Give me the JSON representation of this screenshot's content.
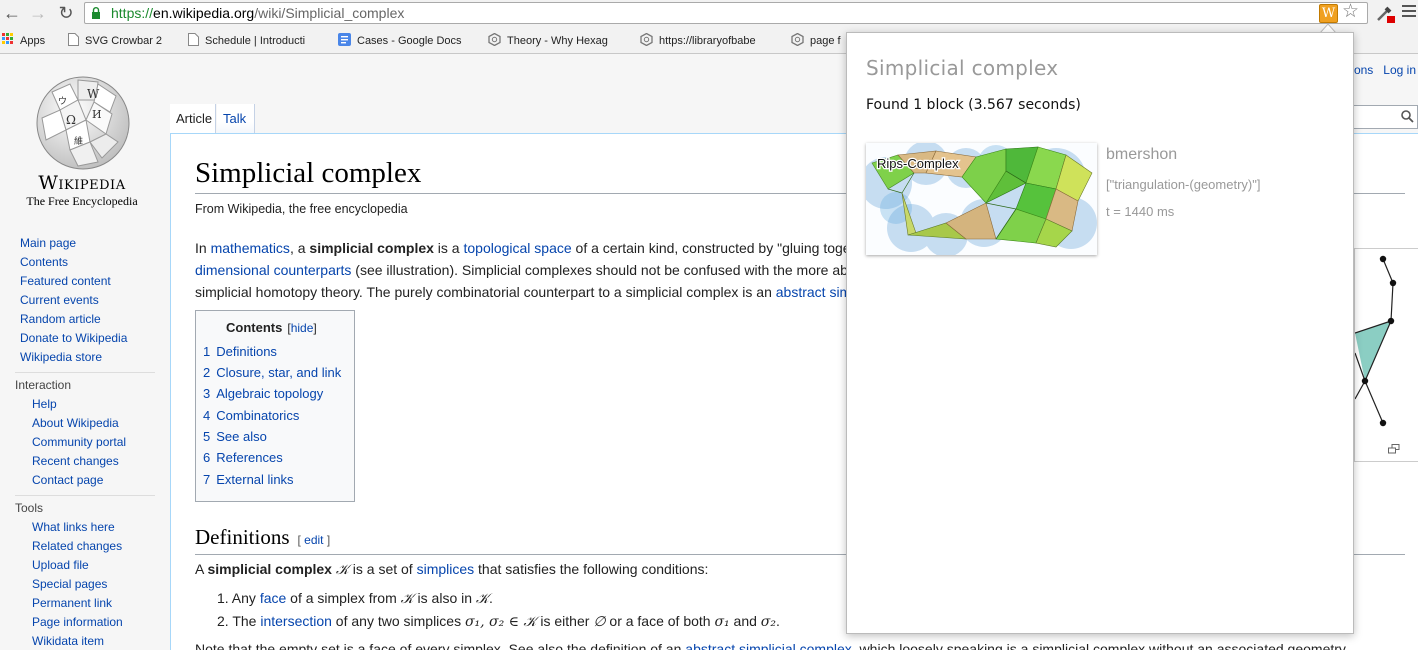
{
  "browser": {
    "url_scheme": "https://",
    "url_host": "en.wikipedia.org",
    "url_path": "/wiki/Simplicial_complex",
    "extension_letter": "W",
    "bookmarks": [
      {
        "label": "Apps",
        "icon": "apps-grid-icon"
      },
      {
        "label": "SVG Crowbar 2",
        "icon": "page-icon"
      },
      {
        "label": "Schedule | Introducti",
        "icon": "page-icon"
      },
      {
        "label": "Cases - Google Docs",
        "icon": "google-docs-icon"
      },
      {
        "label": "Theory - Why Hexag",
        "icon": "site-icon"
      },
      {
        "label": "https://libraryofbabe",
        "icon": "site-icon"
      },
      {
        "label": "page f",
        "icon": "site-icon"
      }
    ]
  },
  "wiki": {
    "wordmark": "Wikipedia",
    "tagline": "The Free Encyclopedia",
    "user_links": "ions   Log in",
    "nav": [
      "Main page",
      "Contents",
      "Featured content",
      "Current events",
      "Random article",
      "Donate to Wikipedia",
      "Wikipedia store"
    ],
    "interaction_heading": "Interaction",
    "interaction": [
      "Help",
      "About Wikipedia",
      "Community portal",
      "Recent changes",
      "Contact page"
    ],
    "tools_heading": "Tools",
    "tools": [
      "What links here",
      "Related changes",
      "Upload file",
      "Special pages",
      "Permanent link",
      "Page information",
      "Wikidata item"
    ],
    "tabs": [
      "Article",
      "Talk"
    ],
    "title": "Simplicial complex",
    "site_sub": "From Wikipedia, the free encyclopedia",
    "intro": {
      "l1_a": "In ",
      "l1_link1": "mathematics",
      "l1_b": ", a ",
      "l1_bold": "simplicial complex",
      "l1_c": " is a ",
      "l1_link2": "topological space",
      "l1_d": " of a certain kind, constructed by \"gluing toge",
      "l2_link": "dimensional counterparts",
      "l2_rest": " (see illustration). Simplicial complexes should not be confused with the more ab",
      "l3_a": "simplicial homotopy theory. The purely combinatorial counterpart to a simplicial complex is an ",
      "l3_link": "abstract sim"
    },
    "toc": {
      "title": "Contents",
      "hide": "hide",
      "items": [
        {
          "num": "1",
          "label": "Definitions"
        },
        {
          "num": "2",
          "label": "Closure, star, and link"
        },
        {
          "num": "3",
          "label": "Algebraic topology"
        },
        {
          "num": "4",
          "label": "Combinatorics"
        },
        {
          "num": "5",
          "label": "See also"
        },
        {
          "num": "6",
          "label": "References"
        },
        {
          "num": "7",
          "label": "External links"
        }
      ]
    },
    "definitions": {
      "heading": "Definitions",
      "edit": "edit",
      "p_a": "A ",
      "p_bold": "simplicial complex",
      "p_sym": "𝒦",
      "p_b": " is a set of ",
      "p_link": "simplices",
      "p_c": " that satisfies the following conditions:",
      "li1_a": "1. Any ",
      "li1_link": "face",
      "li1_b": " of a simplex from ",
      "li1_sym": "𝒦",
      "li1_c": " is also in ",
      "li1_sym2": "𝒦",
      "li1_d": ".",
      "li2_a": "2. The ",
      "li2_link": "intersection",
      "li2_b": " of any two simplices ",
      "li2_math": "σ₁, σ₂ ∈ 𝒦",
      "li2_c": " is either ",
      "li2_empty": "∅",
      "li2_d": " or a face of both ",
      "li2_s1": "σ₁",
      "li2_e": " and ",
      "li2_s2": "σ₂",
      "li2_f": ".",
      "note_a": "Note that the empty set is a face of every simplex. See also the definition of an ",
      "note_link": "abstract simplicial complex",
      "note_b": ", which loosely speaking is a simplicial complex without an associated geometry."
    }
  },
  "popup": {
    "title": "Simplicial complex",
    "status": "Found 1 block (3.567 seconds)",
    "block": {
      "thumb_label": "Rips-Complex",
      "user": "bmershon",
      "tags": "[\"triangulation-(geometry)\"]",
      "time": "t = 1440 ms"
    }
  },
  "colors": {
    "link": "#0645ad",
    "secure_green": "#1b8a2e",
    "extension_orange": "#f0a020",
    "popup_muted": "#999999"
  }
}
